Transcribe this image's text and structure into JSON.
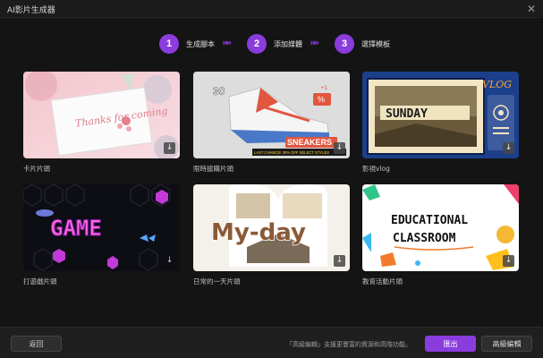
{
  "window": {
    "title": "AI影片生成器",
    "close_glyph": "✕"
  },
  "steps": [
    {
      "number": "1",
      "label": "生成腳本"
    },
    {
      "number": "2",
      "label": "添加媒體"
    },
    {
      "number": "3",
      "label": "選擇模板"
    }
  ],
  "step_separator": "»",
  "templates": [
    {
      "label": "卡片片頭",
      "card_text": "Thanks for coming"
    },
    {
      "label": "限時搶購片頭",
      "card_text": "SNEAKERS",
      "badge_30": "30",
      "badge_sale": "%",
      "badge_count": "+1",
      "banner": "LAST CHANCE! 30% OFF SELECT STYLES"
    },
    {
      "label": "影視vlog",
      "card_text": "SUNDAY",
      "neon": "VLOG"
    },
    {
      "label": "打遊戲片頭",
      "card_text": "GAME"
    },
    {
      "label": "日常的一天片頭",
      "card_text": "My-day"
    },
    {
      "label": "教育活動片頭",
      "card_text_1": "EDUCATIONAL",
      "card_text_2": "CLASSROOM"
    }
  ],
  "download_glyph": "↓",
  "footer": {
    "back_label": "返回",
    "hint": "「高級編輯」支援更豐富的資源和高階功能。",
    "export_label": "匯出",
    "advanced_label": "高級編輯"
  },
  "colors": {
    "accent": "#8a3cdc",
    "background": "#141414",
    "bar": "#1f1f1f"
  }
}
